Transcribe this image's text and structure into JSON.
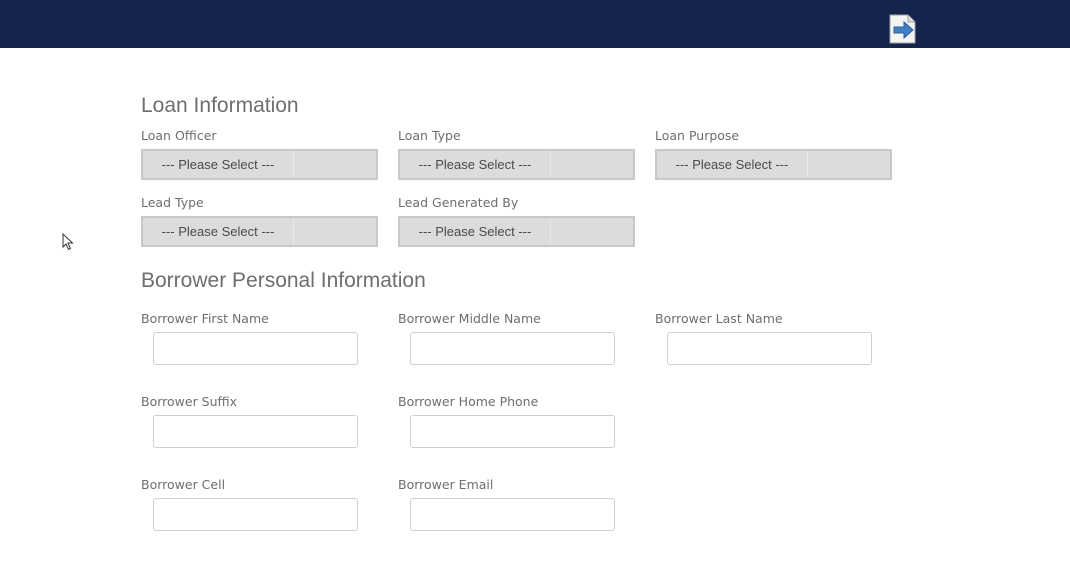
{
  "header": {
    "logout_icon": "logout-icon"
  },
  "loan_information": {
    "title": "Loan Information",
    "fields": {
      "loan_officer": {
        "label": "Loan Officer",
        "value": "--- Please Select ---"
      },
      "loan_type": {
        "label": "Loan Type",
        "value": "--- Please Select ---"
      },
      "loan_purpose": {
        "label": "Loan Purpose",
        "value": "--- Please Select ---"
      },
      "lead_type": {
        "label": "Lead Type",
        "value": "--- Please Select ---"
      },
      "lead_generated_by": {
        "label": "Lead Generated By",
        "value": "--- Please Select ---"
      }
    }
  },
  "borrower_personal_information": {
    "title": "Borrower Personal Information",
    "fields": {
      "first_name": {
        "label": "Borrower First Name",
        "value": ""
      },
      "middle_name": {
        "label": "Borrower Middle Name",
        "value": ""
      },
      "last_name": {
        "label": "Borrower Last Name",
        "value": ""
      },
      "suffix": {
        "label": "Borrower Suffix",
        "value": ""
      },
      "home_phone": {
        "label": "Borrower Home Phone",
        "value": ""
      },
      "cell": {
        "label": "Borrower Cell",
        "value": ""
      },
      "email": {
        "label": "Borrower Email",
        "value": ""
      }
    }
  },
  "colors": {
    "header_bg": "#14244d",
    "label_text": "#6e6e6e",
    "select_bg": "#dcdcdc"
  }
}
